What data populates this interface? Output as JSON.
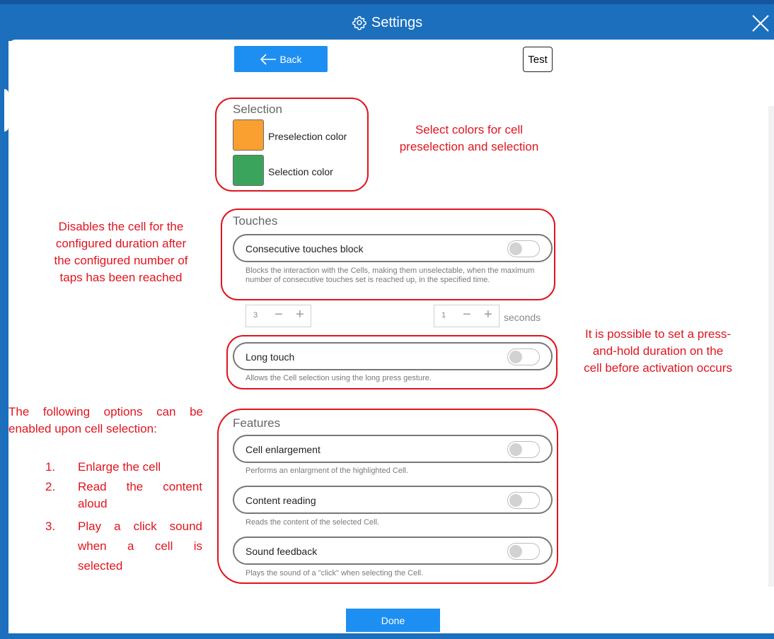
{
  "window": {
    "title": "Settings",
    "colors": {
      "titlebar": "#1b6fbd",
      "primary_button": "#1e8ff2",
      "annotation": "#e0141e"
    }
  },
  "toolbar": {
    "back_label": "Back",
    "test_label": "Test"
  },
  "selection": {
    "title": "Selection",
    "preselection": {
      "label": "Preselection color",
      "color": "#f9a030"
    },
    "selection": {
      "label": "Selection color",
      "color": "#3aa45c"
    }
  },
  "touches": {
    "title": "Touches",
    "consecutive": {
      "label": "Consecutive touches block",
      "enabled": false,
      "description": "Blocks the interaction with the Cells, making them unselectable, when the maximum number of consecutive touches set is reached up, in the specified time."
    },
    "count": {
      "value": "3",
      "minus": "−",
      "plus": "+"
    },
    "duration": {
      "value": "1",
      "minus": "−",
      "plus": "+",
      "unit": "seconds"
    },
    "long_touch": {
      "label": "Long touch",
      "enabled": false,
      "description": "Allows the Cell selection using the long press gesture."
    }
  },
  "features": {
    "title": "Features",
    "items": [
      {
        "label": "Cell enlargement",
        "enabled": false,
        "description": "Performs an enlargment of the highlighted Cell."
      },
      {
        "label": "Content reading",
        "enabled": false,
        "description": "Reads the content of the selected Cell."
      },
      {
        "label": "Sound feedback",
        "enabled": false,
        "description": "Plays the sound of a \"click\" when selecting the Cell."
      }
    ]
  },
  "footer": {
    "done_label": "Done"
  },
  "annotations": {
    "colors": [
      "Select colors for cell",
      "preselection and selection"
    ],
    "touches": [
      "Disables the cell for the",
      "configured duration after",
      "the configured number of",
      "taps has been reached"
    ],
    "long_touch": [
      "It is possible to set a press-",
      "and-hold duration on the",
      "cell before activation occurs"
    ],
    "features_intro": [
      "The following options can be",
      "enabled upon cell selection:"
    ],
    "features_list": [
      {
        "num": "1.",
        "lines": [
          "Enlarge the cell"
        ]
      },
      {
        "num": "2.",
        "lines": [
          "Read the content",
          "aloud"
        ]
      },
      {
        "num": "3.",
        "lines": [
          "Play a click sound",
          "when a cell is",
          "selected"
        ]
      }
    ]
  }
}
